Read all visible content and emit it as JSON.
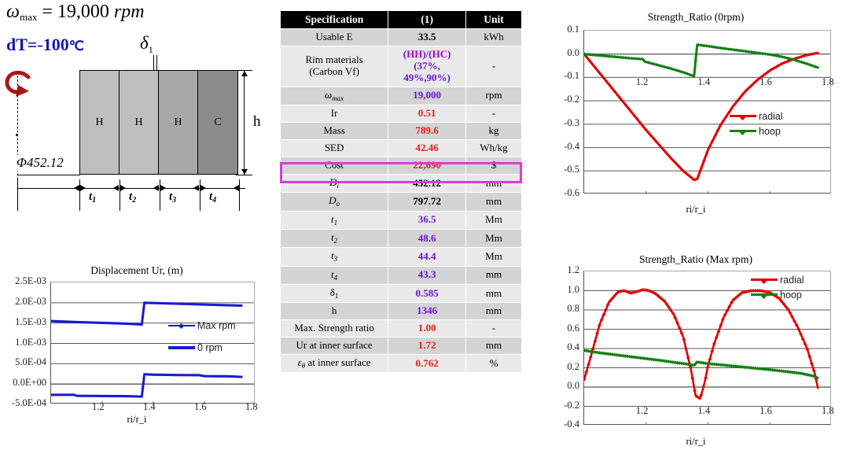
{
  "diagram": {
    "omega_formula": "ω",
    "omega_sub": "max",
    "omega_rest": "= 19,000",
    "omega_unit": "rpm",
    "dt_label": "dT=-100",
    "dt_unit": "℃",
    "delta_symbol": "δ",
    "delta_sub": "1",
    "phi_label": "Φ452.12",
    "h_label": "h",
    "blocks": [
      {
        "label": "H",
        "color": "#bfbfbf"
      },
      {
        "label": "H",
        "color": "#bfbfbf"
      },
      {
        "label": "H",
        "color": "#a8a8a8"
      },
      {
        "label": "C",
        "color": "#8c8c8c"
      }
    ],
    "thickness_labels": [
      "t",
      "t",
      "t",
      "t"
    ],
    "thickness_subs": [
      "1",
      "2",
      "3",
      "4"
    ]
  },
  "table": {
    "headers": [
      "Specification",
      "(1)",
      "Unit"
    ],
    "rows": [
      {
        "spec": "Usable E",
        "value": "33.5",
        "unit": "kWh",
        "color": "black"
      },
      {
        "spec": "Rim materials\n(Carbon Vf)",
        "value": "(HH)/(HC)\n(37%,\n49%,90%)",
        "unit": "-",
        "color": "purple"
      },
      {
        "spec": "ωmax",
        "value": "19,000",
        "unit": "rpm",
        "color": "purple"
      },
      {
        "spec": "Ir",
        "value": "0.51",
        "unit": "-",
        "color": "red"
      },
      {
        "spec": "Mass",
        "value": "789.6",
        "unit": "kg",
        "color": "red"
      },
      {
        "spec": "SED",
        "value": "42.46",
        "unit": "Wh/kg",
        "color": "red"
      },
      {
        "spec": "Cost",
        "value": "22,690",
        "unit": "$",
        "color": "red"
      },
      {
        "spec": "Di",
        "value": "452.12",
        "unit": "mm",
        "color": "black"
      },
      {
        "spec": "Do",
        "value": "797.72",
        "unit": "mm",
        "color": "black"
      },
      {
        "spec": "t1",
        "value": "36.5",
        "unit": "Mm",
        "color": "purple"
      },
      {
        "spec": "t2",
        "value": "48.6",
        "unit": "Mm",
        "color": "purple"
      },
      {
        "spec": "t3",
        "value": "44.4",
        "unit": "Mm",
        "color": "purple"
      },
      {
        "spec": "t4",
        "value": "43.3",
        "unit": "mm",
        "color": "purple"
      },
      {
        "spec": "δ1",
        "value": "0.585",
        "unit": "mm",
        "color": "purple"
      },
      {
        "spec": "h",
        "value": "1346",
        "unit": "mm",
        "color": "purple"
      },
      {
        "spec": "Max. Strength ratio",
        "value": "1.00",
        "unit": "-",
        "color": "red"
      },
      {
        "spec": "Ur at inner surface",
        "value": "1.72",
        "unit": "mm",
        "color": "red"
      },
      {
        "spec": "εθ at inner surface",
        "value": "0.762",
        "unit": "%",
        "color": "red"
      }
    ],
    "highlight_row": "SED",
    "highlight_color": "#d63fd6"
  },
  "chart_data": [
    {
      "id": "strength-ratio-0rpm",
      "type": "line",
      "title": "Strength_Ratio (0rpm)",
      "xlabel": "ri/r_i",
      "ylabel": "",
      "xlim": [
        1.0,
        1.8
      ],
      "ylim": [
        -0.6,
        0.1
      ],
      "xticks": [
        "1.2",
        "1.4",
        "1.6",
        "1.8"
      ],
      "yticks": [
        "0.1",
        "0.0",
        "-0.1",
        "-0.2",
        "-0.3",
        "-0.4",
        "-0.5",
        "-0.6"
      ],
      "grid": true,
      "legend_position": "right-middle",
      "series": [
        {
          "name": "radial",
          "color": "#e00000",
          "x": [
            1.0,
            1.04,
            1.08,
            1.12,
            1.16,
            1.2,
            1.24,
            1.28,
            1.32,
            1.355,
            1.365,
            1.4,
            1.44,
            1.48,
            1.52,
            1.56,
            1.6,
            1.64,
            1.68,
            1.72,
            1.755
          ],
          "values": [
            0.0,
            -0.065,
            -0.13,
            -0.195,
            -0.26,
            -0.325,
            -0.385,
            -0.445,
            -0.5,
            -0.538,
            -0.535,
            -0.41,
            -0.305,
            -0.225,
            -0.16,
            -0.11,
            -0.07,
            -0.04,
            -0.02,
            -0.004,
            0.005
          ]
        },
        {
          "name": "hoop",
          "color": "#128012",
          "x": [
            1.0,
            1.05,
            1.1,
            1.15,
            1.19,
            1.195,
            1.24,
            1.28,
            1.32,
            1.355,
            1.365,
            1.4,
            1.44,
            1.48,
            1.52,
            1.56,
            1.6,
            1.64,
            1.68,
            1.72,
            1.755
          ],
          "values": [
            0.0,
            -0.006,
            -0.012,
            -0.018,
            -0.022,
            -0.032,
            -0.048,
            -0.062,
            -0.078,
            -0.095,
            0.04,
            0.034,
            0.026,
            0.019,
            0.012,
            0.005,
            -0.002,
            -0.012,
            -0.025,
            -0.042,
            -0.058
          ]
        }
      ]
    },
    {
      "id": "strength-ratio-max-rpm",
      "type": "line",
      "title": "Strength_Ratio (Max rpm)",
      "xlabel": "ri/r_i",
      "ylabel": "",
      "xlim": [
        1.0,
        1.8
      ],
      "ylim": [
        -0.4,
        1.2
      ],
      "xticks": [
        "1.2",
        "1.4",
        "1.6",
        "1.8"
      ],
      "yticks": [
        "1.2",
        "1.0",
        "0.8",
        "0.6",
        "0.4",
        "0.2",
        "0.0",
        "-0.2",
        "-0.4"
      ],
      "grid": true,
      "legend_position": "top-right",
      "series": [
        {
          "name": "radial",
          "color": "#e00000",
          "x": [
            1.0,
            1.02,
            1.05,
            1.08,
            1.11,
            1.13,
            1.15,
            1.17,
            1.19,
            1.21,
            1.23,
            1.26,
            1.29,
            1.32,
            1.345,
            1.36,
            1.375,
            1.39,
            1.4,
            1.42,
            1.45,
            1.48,
            1.51,
            1.54,
            1.57,
            1.6,
            1.63,
            1.66,
            1.69,
            1.72,
            1.745,
            1.755
          ],
          "values": [
            0.08,
            0.3,
            0.65,
            0.88,
            0.99,
            1.0,
            0.975,
            0.99,
            1.01,
            1.0,
            0.97,
            0.89,
            0.75,
            0.52,
            0.18,
            -0.09,
            -0.12,
            0.06,
            0.22,
            0.45,
            0.72,
            0.9,
            0.98,
            1.0,
            1.0,
            0.98,
            0.92,
            0.8,
            0.62,
            0.4,
            0.14,
            -0.01
          ]
        },
        {
          "name": "hoop",
          "color": "#128012",
          "x": [
            1.0,
            1.05,
            1.1,
            1.15,
            1.2,
            1.25,
            1.3,
            1.34,
            1.355,
            1.365,
            1.4,
            1.45,
            1.5,
            1.55,
            1.6,
            1.65,
            1.7,
            1.74,
            1.755
          ],
          "values": [
            0.38,
            0.355,
            0.335,
            0.315,
            0.295,
            0.275,
            0.252,
            0.235,
            0.225,
            0.26,
            0.243,
            0.228,
            0.212,
            0.196,
            0.18,
            0.162,
            0.142,
            0.115,
            0.095
          ]
        }
      ]
    },
    {
      "id": "displacement-ur",
      "type": "line",
      "title": "Displacement Ur, (m)",
      "xlabel": "ri/r_i",
      "ylabel": "",
      "xlim": [
        1.0,
        1.8
      ],
      "ylim": [
        -0.0005,
        0.0025
      ],
      "xticks": [
        "1.2",
        "1.4",
        "1.6",
        "1.8"
      ],
      "yticks": [
        "2.5E-03",
        "2.0E-03",
        "1.5E-03",
        "1.0E-03",
        "5.0E-04",
        "0.0E+00",
        "-5.0E-04"
      ],
      "grid": true,
      "legend_position": "inside-right",
      "series": [
        {
          "name": "Max rpm",
          "color": "#1a1ad0",
          "x": [
            1.0,
            1.1,
            1.2,
            1.3,
            1.355,
            1.365,
            1.45,
            1.55,
            1.65,
            1.745
          ],
          "values": [
            0.00155,
            0.001525,
            0.001505,
            0.001485,
            0.001465,
            0.002,
            0.001985,
            0.001965,
            0.001945,
            0.00193
          ]
        },
        {
          "name": "0 rpm",
          "color": "#1a1ad0",
          "x": [
            1.0,
            1.09,
            1.1,
            1.2,
            1.3,
            1.355,
            1.365,
            1.4,
            1.5,
            1.58,
            1.6,
            1.7,
            1.745
          ],
          "values": [
            -0.000265,
            -0.000265,
            -0.00029,
            -0.000295,
            -0.0003,
            -0.00031,
            0.00024,
            0.00023,
            0.00022,
            0.000218,
            0.000195,
            0.00019,
            0.000175
          ]
        }
      ]
    }
  ]
}
